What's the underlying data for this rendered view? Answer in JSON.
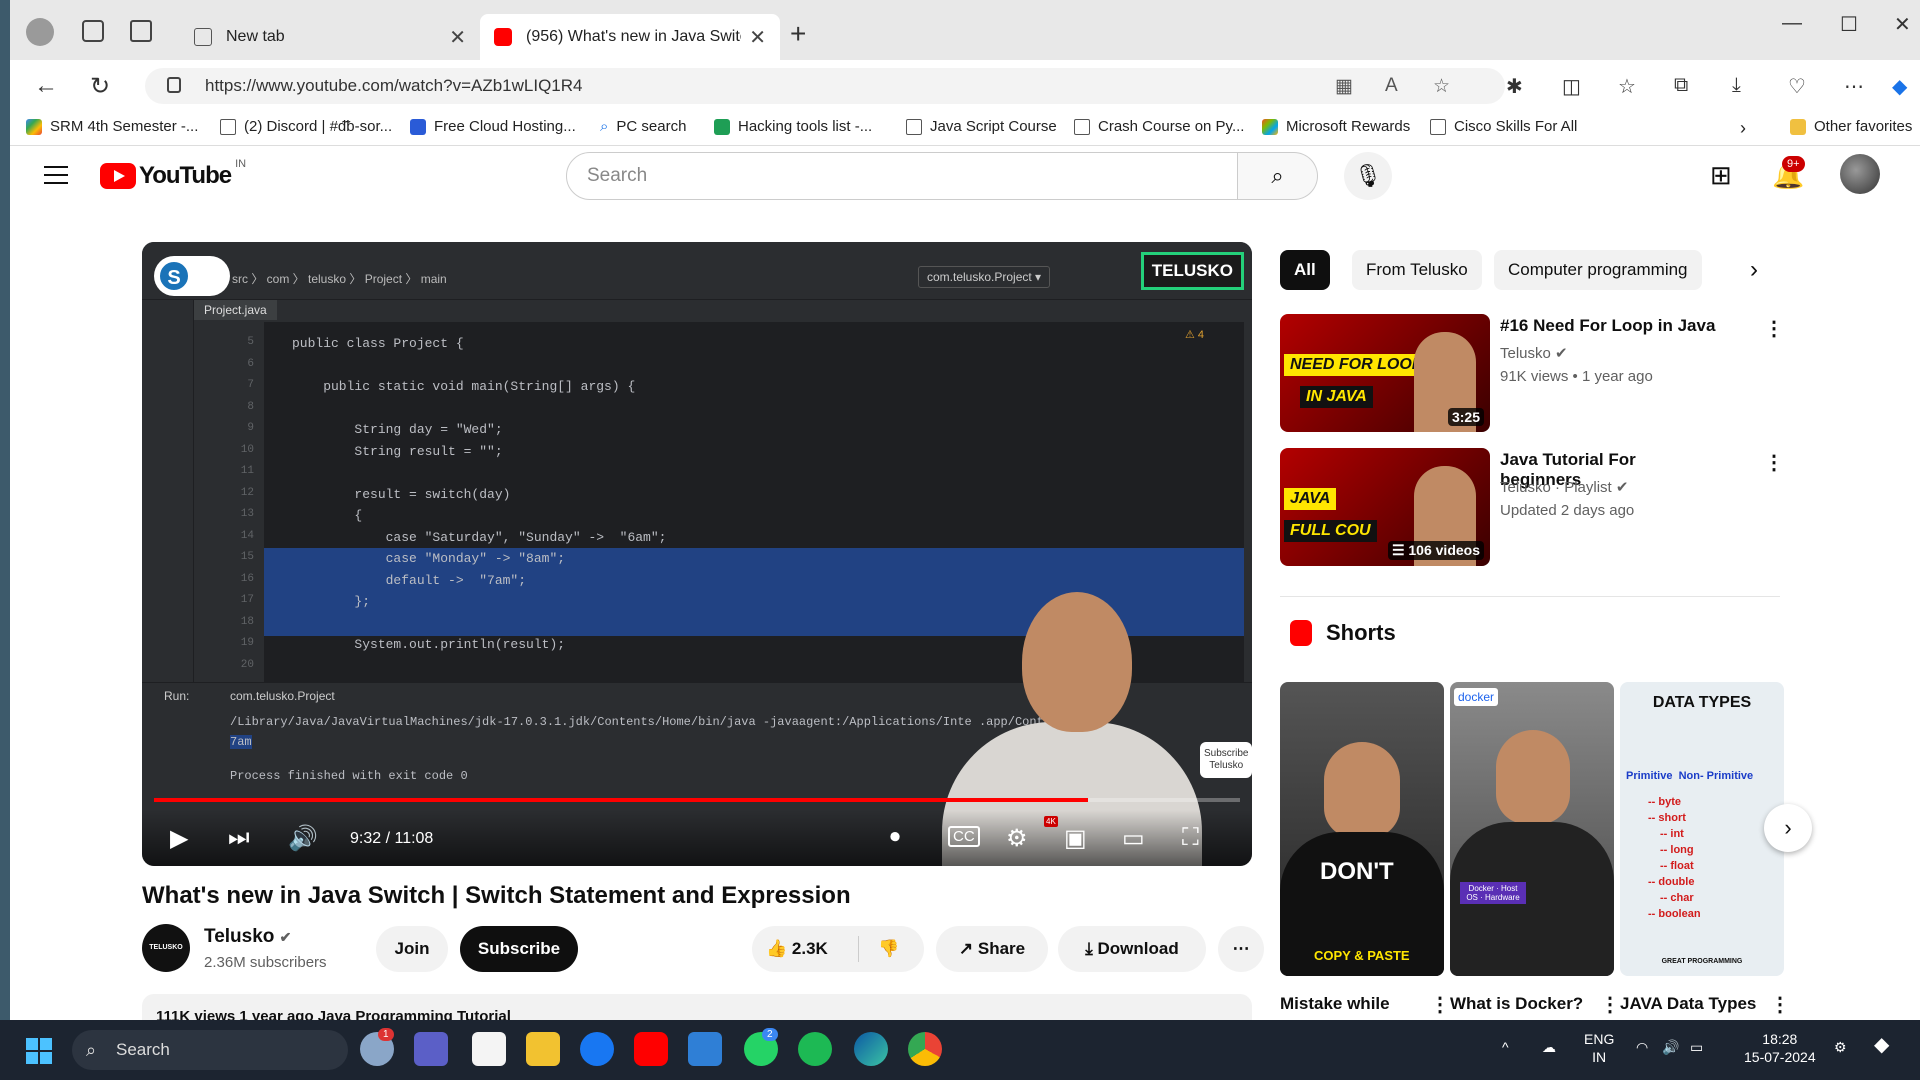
{
  "browser": {
    "tabs": [
      {
        "label": "New tab",
        "active": false
      },
      {
        "label": "(956) What's new in Java Switch |",
        "active": true
      }
    ],
    "url": "https://www.youtube.com/watch?v=AZb1wLIQ1R4",
    "bookmarks": [
      "SRM 4th Semester -...",
      "(2) Discord | #ᵭᵬ-sor...",
      "Free Cloud Hosting...",
      "PC search",
      "Hacking tools list -...",
      "Java Script Course",
      "Crash Course on Py...",
      "Microsoft Rewards",
      "Cisco Skills For All"
    ],
    "other_favorites": "Other favorites"
  },
  "youtube": {
    "country_code": "IN",
    "search_placeholder": "Search",
    "notification_count": "9+"
  },
  "player": {
    "ide": {
      "breadcrumbs": "src 〉 com 〉 telusko 〉 Project 〉 main",
      "file_tab": "Project.java",
      "run_config": "com.telusko.Project ▾",
      "warning_count": "4",
      "code_lines": [
        {
          "n": "5",
          "text": "public class Project {"
        },
        {
          "n": "6",
          "text": ""
        },
        {
          "n": "7",
          "text": "    public static void main(String[] args) {"
        },
        {
          "n": "8",
          "text": ""
        },
        {
          "n": "9",
          "text": "        String day = \"Wed\";"
        },
        {
          "n": "10",
          "text": "        String result = \"\";"
        },
        {
          "n": "11",
          "text": ""
        },
        {
          "n": "12",
          "text": "        result = switch(day)"
        },
        {
          "n": "13",
          "text": "        {"
        },
        {
          "n": "14",
          "text": "            case \"Saturday\", \"Sunday\" ->  \"6am\";"
        },
        {
          "n": "15",
          "text": "            case \"Monday\" -> \"8am\";"
        },
        {
          "n": "16",
          "text": "            default ->  \"7am\";"
        },
        {
          "n": "17",
          "text": "        };"
        },
        {
          "n": "18",
          "text": ""
        },
        {
          "n": "19",
          "text": "        System.out.println(result);"
        },
        {
          "n": "20",
          "text": ""
        }
      ],
      "run_label": "Run:",
      "run_config_tab": "com.telusko.Project",
      "output_lines": [
        "/Library/Java/JavaVirtualMachines/jdk-17.0.3.1.jdk/Contents/Home/bin/java -javaagent:/Applications/Inte",
        "7am",
        "Process finished with exit code 0"
      ],
      "output_suffix": ".app/Contents/l"
    },
    "watermark": "TELUSKO",
    "subscribe_card": [
      "Subscribe",
      "Telusko"
    ],
    "time": "9:32 / 11:08",
    "progress_fraction": 0.86,
    "quality_badge": "4K",
    "cc_label": "CC"
  },
  "video": {
    "title": "What's new in Java Switch | Switch Statement and Expression",
    "channel": "Telusko",
    "subscribers": "2.36M subscribers",
    "channel_avatar_text": "TELUSKO",
    "join": "Join",
    "subscribe": "Subscribe",
    "likes": "2.3K",
    "share": "Share",
    "download": "Download",
    "description_preview": "111K views  1 year ago  Java Programming Tutorial"
  },
  "sidebar": {
    "chips": [
      "All",
      "From Telusko",
      "Computer programming"
    ],
    "recommendations": [
      {
        "title": "#16 Need For Loop in Java",
        "channel": "Telusko",
        "stats": "91K views  •  1 year ago",
        "duration": "3:25",
        "thumb_lines": [
          "NEED FOR LOOP",
          "IN JAVA"
        ]
      },
      {
        "title": "Java Tutorial For beginners",
        "channel": "Telusko · Playlist",
        "stats": "Updated 2 days ago",
        "duration": "106 videos",
        "thumb_lines": [
          "JAVA",
          "FULL COU"
        ]
      }
    ],
    "shorts_heading": "Shorts",
    "shorts": [
      {
        "title": "Mistake while",
        "thumb_text": "DON'T",
        "thumb_sub": "COPY & PASTE"
      },
      {
        "title": "What is Docker?",
        "thumb_text": "docker",
        "thumb_sub": "Docker · Host OS · Hardware"
      },
      {
        "title": "JAVA Data Types",
        "thumb_text": "DATA TYPES",
        "thumb_sub": "Primitive  Non- Primitive"
      }
    ],
    "data_types": [
      "byte",
      "short",
      "int",
      "long",
      "float",
      "double",
      "char",
      "boolean"
    ],
    "data_types_footer": "GREAT PROGRAMMING"
  },
  "taskbar": {
    "search": "Search",
    "teams_badge": "1",
    "whatsapp_badge": "2",
    "language": [
      "ENG",
      "IN"
    ],
    "time": "18:28",
    "date": "15-07-2024"
  },
  "colors": {
    "youtube_red": "#ff0000",
    "selection_blue": "#214283",
    "telusko_green": "#24d07a"
  }
}
